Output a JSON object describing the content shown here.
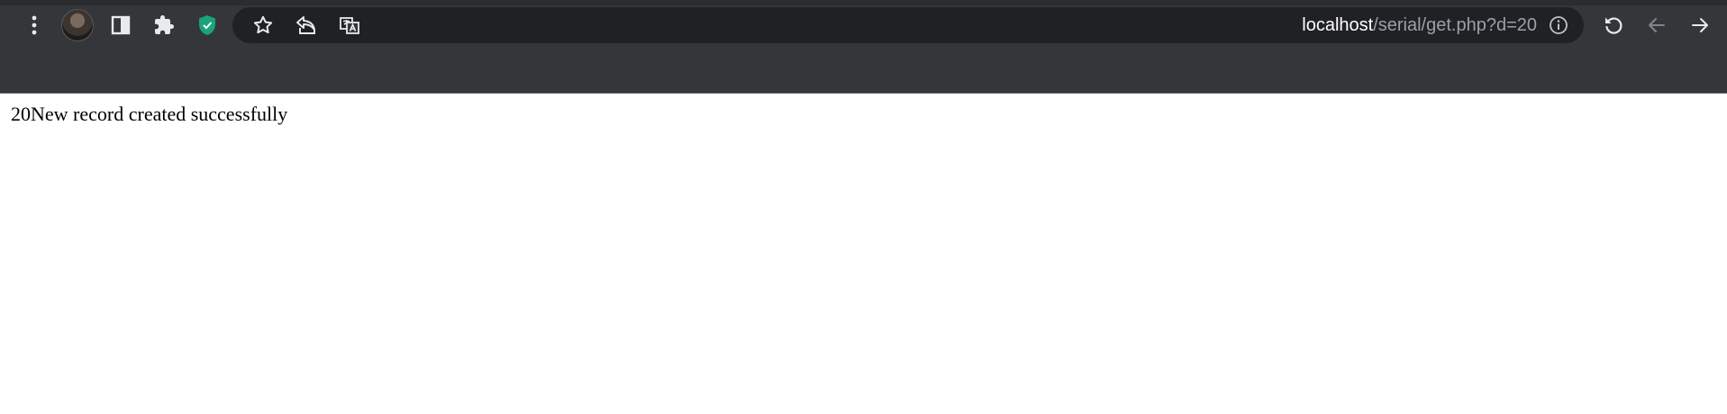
{
  "browser": {
    "address_bar": {
      "host": "localhost",
      "path": "/serial/get.php?d=20"
    },
    "icons": {
      "menu": "kebab-menu-icon",
      "profile": "profile-avatar",
      "side_panel": "side-panel-icon",
      "extensions": "puzzle-piece-icon",
      "shield": "shield-check-icon",
      "bookmark": "star-icon",
      "share": "share-icon",
      "translate": "translate-icon",
      "info": "info-icon",
      "reload": "reload-icon",
      "back": "back-arrow-icon",
      "forward": "forward-arrow-icon"
    },
    "colors": {
      "chrome_bg": "#35363a",
      "omnibox_bg": "#202124",
      "shield_accent": "#1aa37a"
    }
  },
  "page": {
    "body_text": "20New record created successfully"
  }
}
